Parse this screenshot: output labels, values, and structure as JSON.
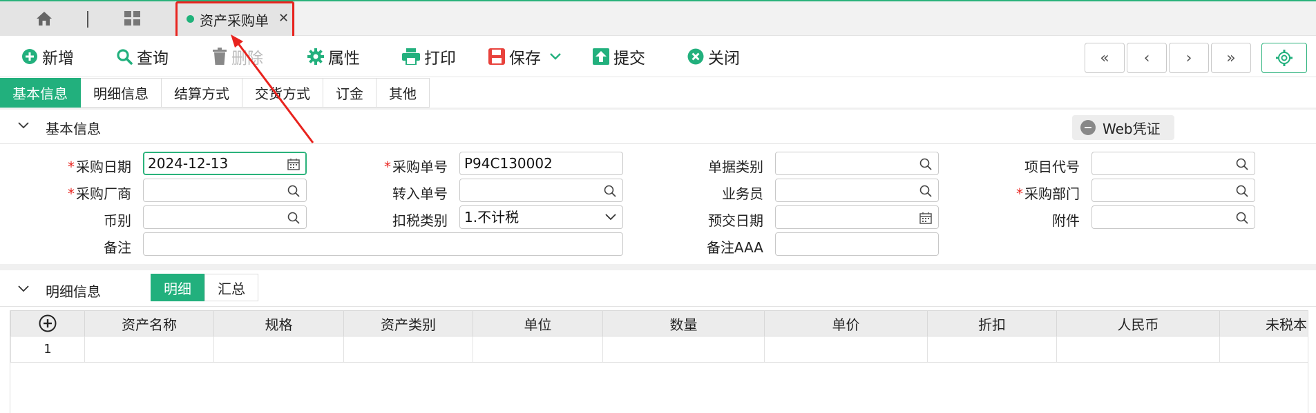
{
  "tabs": {
    "active_title": "资产采购单"
  },
  "toolbar": {
    "add": "新增",
    "query": "查询",
    "delete": "删除",
    "properties": "属性",
    "print": "打印",
    "save": "保存",
    "submit": "提交",
    "close": "关闭"
  },
  "nav": {
    "first": "«",
    "prev": "‹",
    "next": "›",
    "last": "»"
  },
  "section_tabs": [
    "基本信息",
    "明细信息",
    "结算方式",
    "交货方式",
    "订金",
    "其他"
  ],
  "basic_section": {
    "title": "基本信息",
    "web_voucher": "Web凭证"
  },
  "form": {
    "purchase_date": {
      "label": "采购日期",
      "value": "2024-12-13"
    },
    "purchase_no": {
      "label": "采购单号",
      "value": "P94C130002"
    },
    "doc_type": {
      "label": "单据类别",
      "value": ""
    },
    "project_code": {
      "label": "项目代号",
      "value": ""
    },
    "vendor": {
      "label": "采购厂商",
      "value": ""
    },
    "transfer_no": {
      "label": "转入单号",
      "value": ""
    },
    "salesperson": {
      "label": "业务员",
      "value": ""
    },
    "purchase_dept": {
      "label": "采购部门",
      "value": ""
    },
    "currency": {
      "label": "币别",
      "value": ""
    },
    "tax_type": {
      "label": "扣税类别",
      "value": "1.不计税"
    },
    "expected_date": {
      "label": "预交日期",
      "value": ""
    },
    "attachment": {
      "label": "附件",
      "value": ""
    },
    "remark": {
      "label": "备注",
      "value": ""
    },
    "remark_aaa": {
      "label": "备注AAA",
      "value": ""
    }
  },
  "detail_section": {
    "title": "明细信息",
    "sub_tabs": [
      "明细",
      "汇总"
    ]
  },
  "grid": {
    "columns": [
      "资产名称",
      "规格",
      "资产类别",
      "单位",
      "数量",
      "单价",
      "折扣",
      "人民币",
      "未税本币"
    ],
    "rows": [
      [
        "1"
      ]
    ]
  },
  "colors": {
    "accent": "#22b07d",
    "annotation": "#e8231e"
  }
}
